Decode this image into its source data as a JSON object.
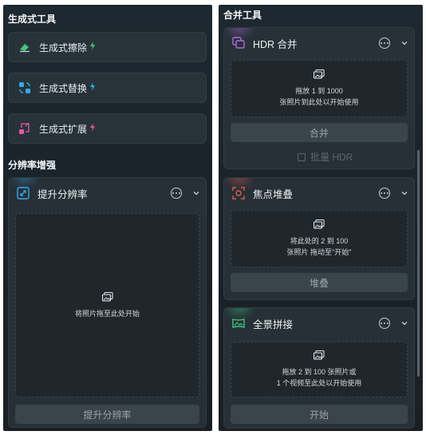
{
  "left_panel": {
    "generative_title": "生成式工具",
    "tools": [
      {
        "label": "生成式擦除",
        "icon": "eraser-icon"
      },
      {
        "label": "生成式替换",
        "icon": "replace-icon"
      },
      {
        "label": "生成式扩展",
        "icon": "expand-icon"
      }
    ],
    "enhance_title": "分辨率增强",
    "upscale": {
      "title": "提升分辨率",
      "icon": "upscale-icon",
      "drop_text": "将照片拖至此处开始",
      "button": "提升分辨率"
    }
  },
  "right_panel": {
    "title": "合并工具",
    "hdr": {
      "title": "HDR 合并",
      "icon": "hdr-merge-icon",
      "drop_line1": "拖放 1 到 1000",
      "drop_line2": "张照片到此处以开始使用",
      "button": "合并",
      "batch_label": "批量 HDR"
    },
    "focus": {
      "title": "焦点堆叠",
      "icon": "focus-stack-icon",
      "drop_line1": "将此处的 2 到 100",
      "drop_line2": "张照片 拖动至\"开始\"",
      "button": "堆叠"
    },
    "panorama": {
      "title": "全景拼接",
      "icon": "panorama-icon",
      "drop_line1": "拖放 2 到 100 张照片或",
      "drop_line2": "1 个视频至此处以开始使用",
      "button": "开始"
    }
  },
  "colors": {
    "accent_green": "#3ec77a",
    "accent_blue": "#35a9e8",
    "accent_pink": "#e357a8",
    "accent_purple": "#b06ce0",
    "accent_red": "#e05a4f"
  }
}
